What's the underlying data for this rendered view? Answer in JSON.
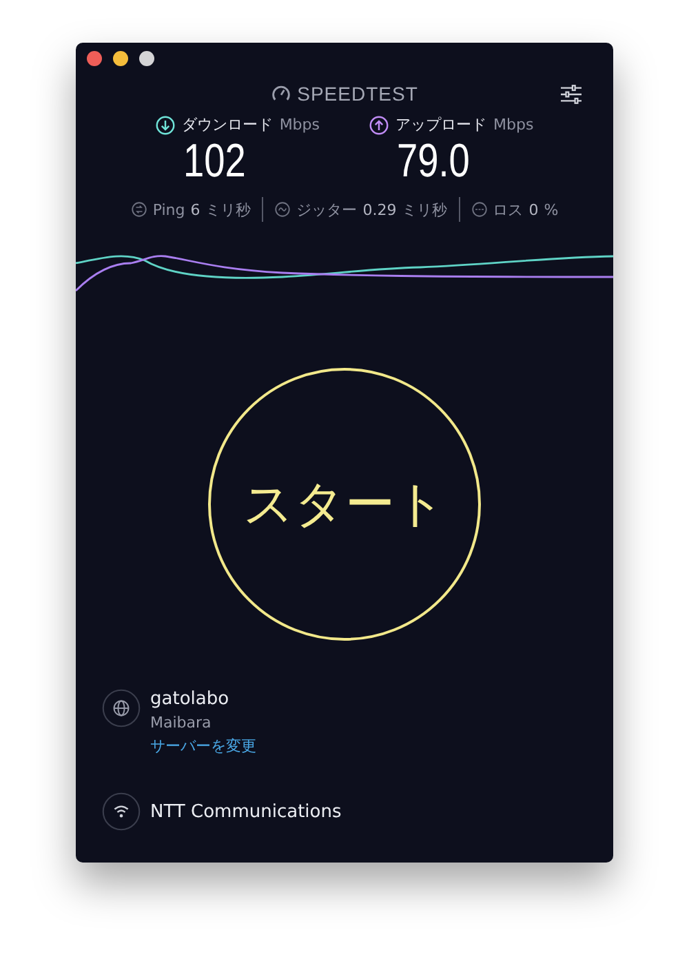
{
  "app": {
    "logo": "SPEEDTEST"
  },
  "results": [
    {
      "kind": "download",
      "label": "ダウンロード",
      "unit": "Mbps",
      "value": "102"
    },
    {
      "kind": "upload",
      "label": "アップロード",
      "unit": "Mbps",
      "value": "79.0"
    }
  ],
  "stats": [
    {
      "kind": "ping",
      "label": "Ping",
      "value": "6",
      "unit": "ミリ秒"
    },
    {
      "kind": "jitter",
      "label": "ジッター",
      "value": "0.29",
      "unit": "ミリ秒"
    },
    {
      "kind": "loss",
      "label": "ロス",
      "value": "0",
      "unit": "%"
    }
  ],
  "start_button": "スタート",
  "server": {
    "name": "gatolabo",
    "location": "Maibara",
    "change_link": "サーバーを変更"
  },
  "provider": {
    "name": "NTT Communications"
  }
}
